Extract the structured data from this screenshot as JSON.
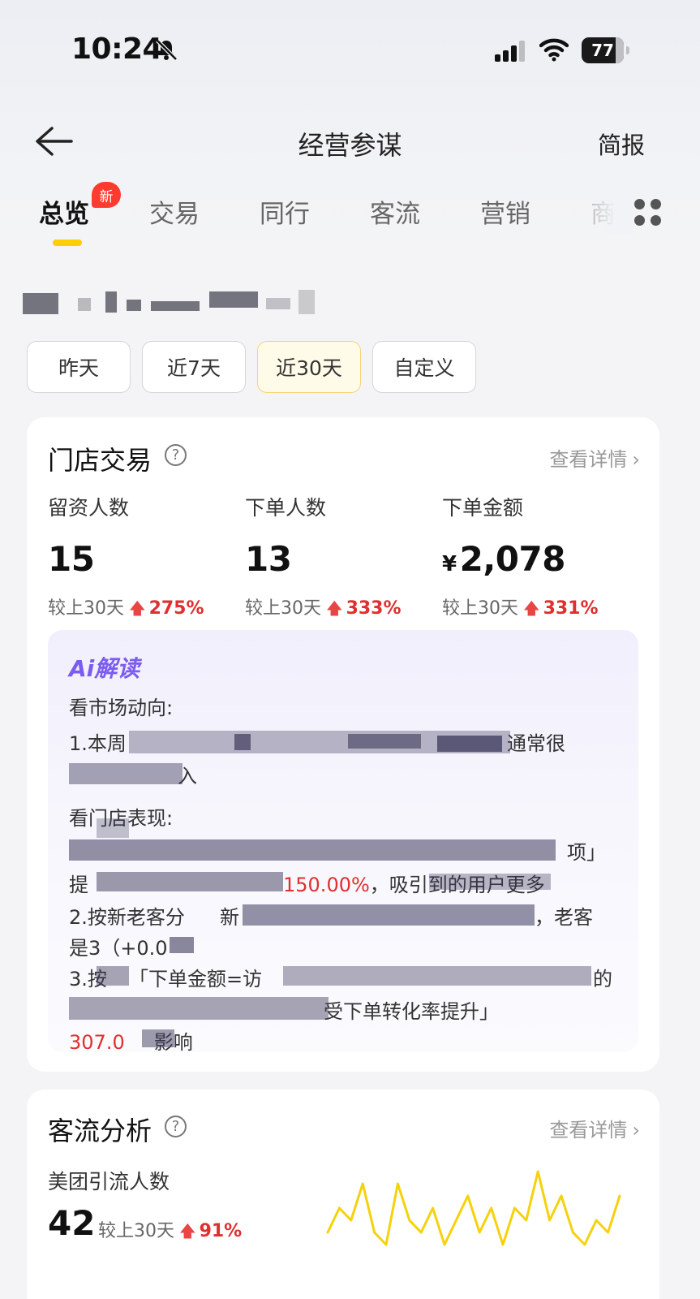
{
  "status_bar": {
    "time": "10:24",
    "battery": "77",
    "icons": [
      "bell-slash-icon",
      "cellular-signal-icon",
      "wifi-icon",
      "battery-icon"
    ]
  },
  "nav": {
    "title": "经营参谋",
    "right_action": "简报",
    "back_icon": "back-arrow-icon"
  },
  "tabs": {
    "items": [
      {
        "label": "总览",
        "active": true,
        "badge": "新"
      },
      {
        "label": "交易"
      },
      {
        "label": "同行"
      },
      {
        "label": "客流"
      },
      {
        "label": "营销"
      },
      {
        "label": "商"
      }
    ],
    "more_icon": "grid-dots-icon",
    "accent": "#ffcd00",
    "badge_color": "#ff3b30"
  },
  "date_filters": {
    "options": [
      "昨天",
      "近7天",
      "近30天",
      "自定义"
    ],
    "selected": "近30天"
  },
  "store_trade": {
    "title": "门店交易",
    "detail_link": "查看详情",
    "metrics": [
      {
        "label": "留资人数",
        "value": "15",
        "compare_label": "较上30天",
        "change": "275%"
      },
      {
        "label": "下单人数",
        "value": "13",
        "compare_label": "较上30天",
        "change": "333%"
      },
      {
        "label": "下单金额",
        "currency": "¥",
        "value": "2,078",
        "compare_label": "较上30天",
        "change": "331%"
      }
    ],
    "up_color": "#e02f2f"
  },
  "ai_reading": {
    "title": "Ai解读",
    "section1_heading": "看市场动向:",
    "line1_start": "1.本周",
    "line1_end": "通常很",
    "line2_end": "入",
    "section2_heading": "看门店表现:",
    "line3_end": "项」",
    "line4_start": "提",
    "line4_highlight": "150.00%",
    "line4_end": "，吸引到的用户更多",
    "line5_start": "2.按新老客分",
    "line5_mid": "新",
    "line5_end": "，老客",
    "line6": "是3（+0.0",
    "line7_start": "3.按",
    "line7_mid": "「下单金额=访",
    "line7_end": "的",
    "line8_end": "受下单转化率提升」",
    "line9_highlight": "307.0",
    "line9_end": "影响",
    "accent": "#7b5cf0"
  },
  "traffic": {
    "title": "客流分析",
    "detail_link": "查看详情",
    "metric_label": "美团引流人数",
    "value": "42",
    "compare_label": "较上30天",
    "change": "91%",
    "sparkline_color": "#f5d20b",
    "sparkline_values": [
      3,
      5,
      4,
      7,
      3,
      2,
      7,
      4,
      3,
      5,
      2,
      4,
      6,
      3,
      5,
      2,
      5,
      4,
      8,
      4,
      6,
      3,
      2,
      4,
      3,
      6
    ]
  }
}
